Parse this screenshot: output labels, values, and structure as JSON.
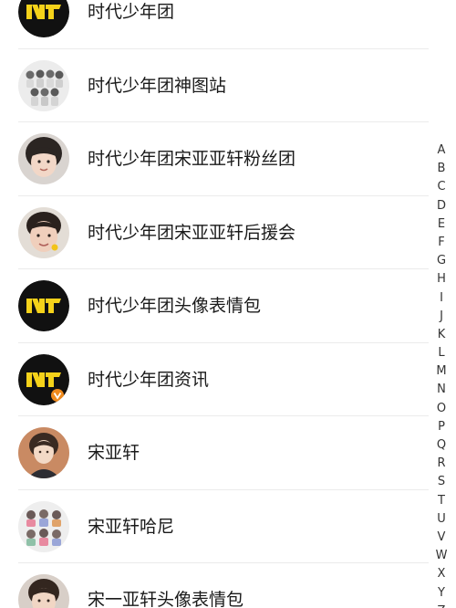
{
  "contacts": [
    {
      "name": "时代少年团",
      "avatar": "tnt-logo-icon"
    },
    {
      "name": "时代少年团神图站",
      "avatar": "group-photo-avatar"
    },
    {
      "name": "时代少年团宋亚亚轩粉丝团",
      "avatar": "portrait-avatar"
    },
    {
      "name": "时代少年团宋亚亚轩后援会",
      "avatar": "portrait-avatar"
    },
    {
      "name": "时代少年团头像表情包",
      "avatar": "tnt-logo-icon"
    },
    {
      "name": "时代少年团资讯",
      "avatar": "tnt-logo-verified-icon"
    },
    {
      "name": "宋亚轩",
      "avatar": "portrait-avatar"
    },
    {
      "name": "宋亚轩哈尼",
      "avatar": "sticker-grid-avatar"
    },
    {
      "name": "宋一亚轩头像表情包",
      "avatar": "portrait-avatar"
    }
  ],
  "index_letters": [
    "A",
    "B",
    "C",
    "D",
    "E",
    "F",
    "G",
    "H",
    "I",
    "J",
    "K",
    "L",
    "M",
    "N",
    "O",
    "P",
    "Q",
    "R",
    "S",
    "T",
    "U",
    "V",
    "W",
    "X",
    "Y",
    "Z"
  ],
  "colors": {
    "logo_background": "#111111",
    "logo_mark": "#f5d21a",
    "verified_badge": "#f08a1c",
    "divider": "#ebebeb",
    "text": "#1a1a1a"
  }
}
